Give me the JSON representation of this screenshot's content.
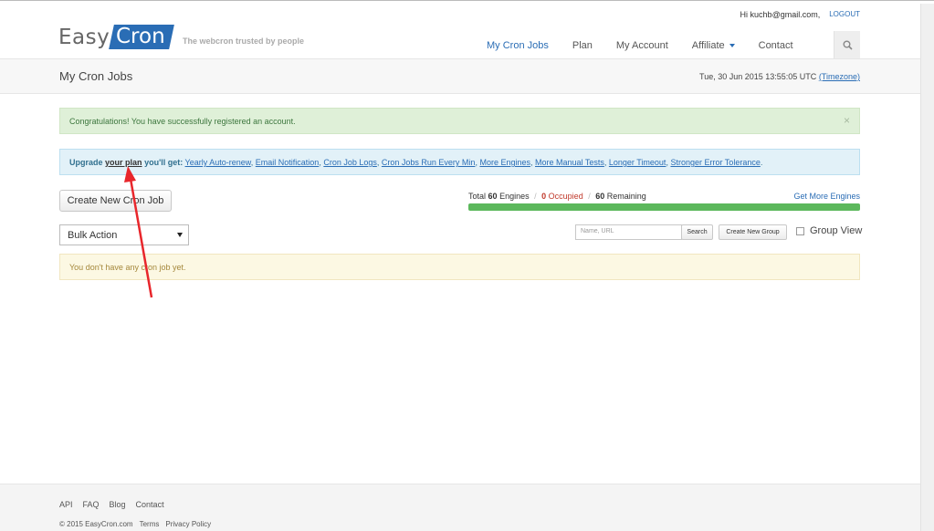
{
  "header": {
    "greeting": "Hi kuchb@gmail.com,",
    "logout": "LOGOUT",
    "logo_part1": "Easy",
    "logo_part2": "Cron",
    "tagline": "The webcron trusted by people",
    "nav": [
      "My Cron Jobs",
      "Plan",
      "My Account",
      "Affiliate",
      "Contact"
    ],
    "search_icon": "search-icon"
  },
  "subheader": {
    "title": "My Cron Jobs",
    "datetime": "Tue, 30 Jun 2015 13:55:05 UTC",
    "timezone_link": "(Timezone)"
  },
  "alerts": {
    "success": "Congratulations! You have successfully registered an account.",
    "close": "×",
    "info_prefix": "Upgrade",
    "info_plan": "your plan",
    "info_suffix": "you'll get:",
    "info_links": [
      "Yearly Auto-renew",
      "Email Notification",
      "Cron Job Logs",
      "Cron Jobs Run Every Min",
      "More Engines",
      "More Manual Tests",
      "Longer Timeout",
      "Stronger Error Tolerance"
    ],
    "empty": "You don't have any cron job yet."
  },
  "actions": {
    "create_button": "Create New Cron Job",
    "bulk_action": "Bulk Action",
    "search_placeholder": "Name, URL",
    "search_button": "Search",
    "create_group_button": "Create New Group",
    "group_view": "Group View"
  },
  "engines": {
    "total_label": "Total",
    "total": "60",
    "total_unit": "Engines",
    "occupied": "0",
    "occupied_label": "Occupied",
    "remaining": "60",
    "remaining_label": "Remaining",
    "get_more": "Get More Engines",
    "occupied_fraction": 0
  },
  "footer": {
    "links": [
      "API",
      "FAQ",
      "Blog",
      "Contact"
    ],
    "copyright": "© 2015 EasyCron.com",
    "terms": "Terms",
    "privacy": "Privacy Policy"
  },
  "colors": {
    "brand": "#2a6db5",
    "annotation_arrow": "#e8262b"
  }
}
